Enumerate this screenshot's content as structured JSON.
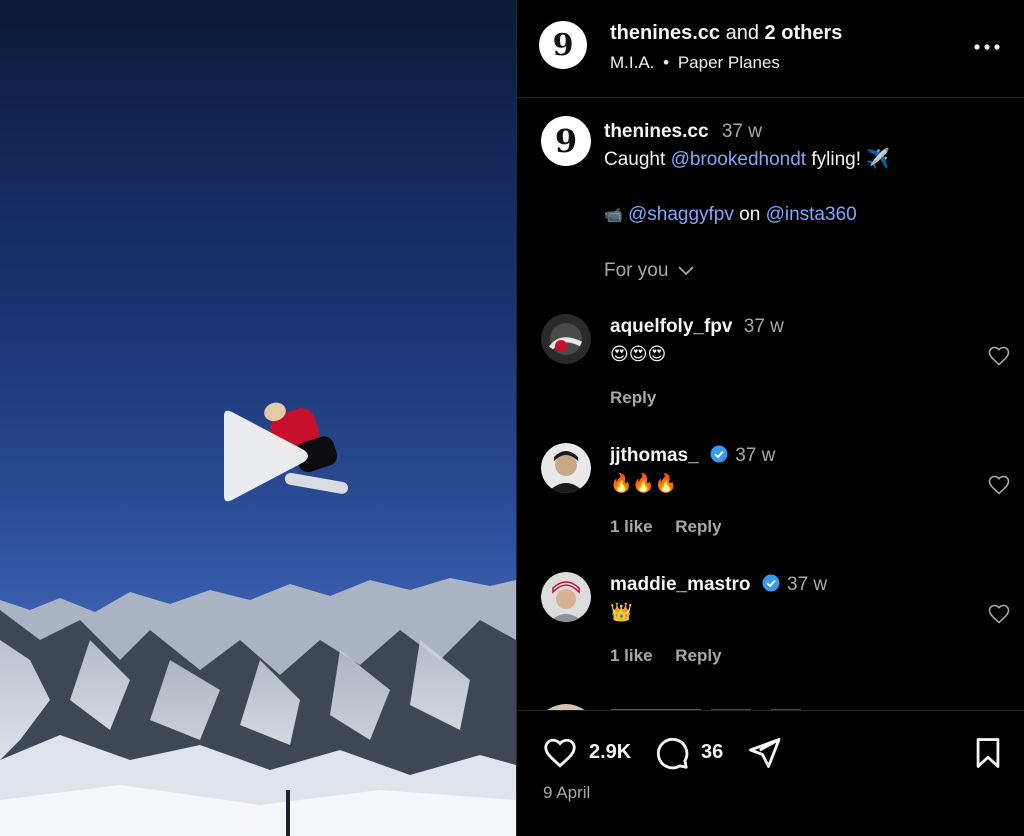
{
  "header": {
    "account": "thenines.cc",
    "collab_joiner": "and",
    "collab_others": "2 others",
    "audio_artist": "M.I.A.",
    "audio_sep": "•",
    "audio_track": "Paper Planes",
    "avatar_glyph": "9"
  },
  "caption": {
    "username": "thenines.cc",
    "time": "37 w",
    "text_prefix": "Caught",
    "mention1": "@brookedhondt",
    "text_suffix": "fyling! ✈️",
    "credit_icon": "📹",
    "mention2": "@shaggyfpv",
    "credit_on": "on",
    "mention3": "@insta360",
    "for_you": "For you"
  },
  "comments": [
    {
      "username": "aquelfoly_fpv",
      "time": "37 w",
      "text": "😍😍😍",
      "likes": "",
      "reply": "Reply",
      "verified": false
    },
    {
      "username": "jjthomas_",
      "time": "37 w",
      "text": "🔥🔥🔥",
      "likes": "1 like",
      "reply": "Reply",
      "verified": true
    },
    {
      "username": "maddie_mastro",
      "time": "37 w",
      "text": "👑",
      "likes": "1 like",
      "reply": "Reply",
      "verified": true
    }
  ],
  "footer": {
    "like_count": "2.9K",
    "comment_count": "36",
    "date": "9 April"
  },
  "colors": {
    "accent": "#7ea7ff",
    "verified": "#3897f0",
    "muted": "#a8a8a8",
    "divider": "#262626"
  }
}
